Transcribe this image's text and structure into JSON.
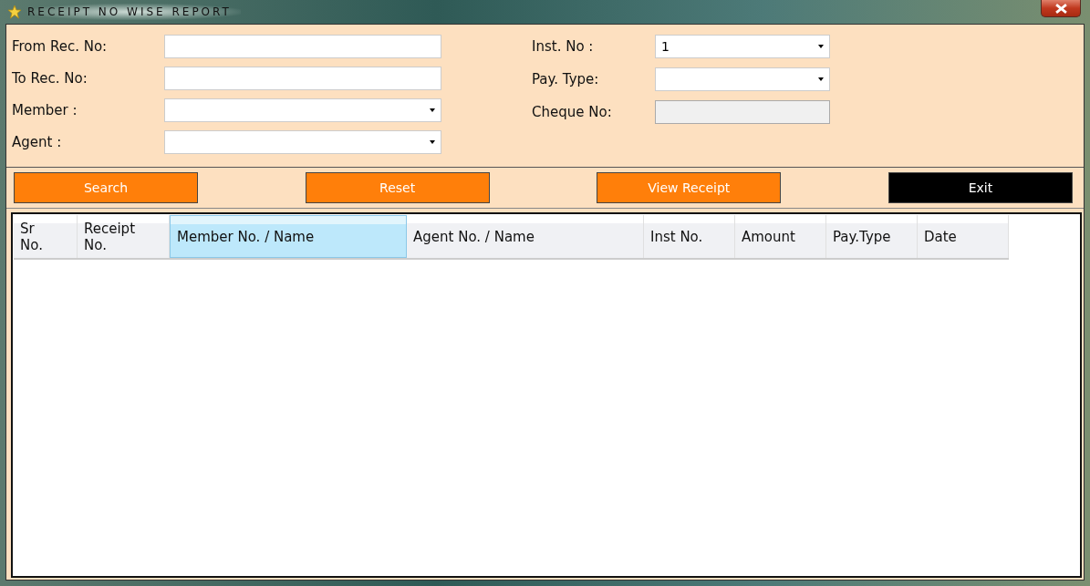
{
  "window": {
    "title": "RECEIPT NO WISE REPORT"
  },
  "left_fields": [
    {
      "label": "From Rec. No:",
      "kind": "text"
    },
    {
      "label": "To Rec. No:",
      "kind": "text"
    },
    {
      "label": "Member :",
      "kind": "select"
    },
    {
      "label": "Agent :",
      "kind": "select"
    }
  ],
  "right_fields": [
    {
      "label": "Inst. No :",
      "kind": "select",
      "value": "1"
    },
    {
      "label": "Pay. Type:",
      "kind": "select"
    },
    {
      "label": "Cheque No:",
      "kind": "disabled"
    }
  ],
  "buttons": [
    {
      "label": "Search",
      "kind": "primary"
    },
    {
      "label": "Reset",
      "kind": "primary"
    },
    {
      "label": "View Receipt",
      "kind": "primary"
    },
    {
      "label": "Exit",
      "kind": "dark"
    }
  ],
  "table": {
    "columns": [
      {
        "label": "Sr\nNo.",
        "selected": false
      },
      {
        "label": "Receipt\nNo.",
        "selected": false
      },
      {
        "label": "Member No. / Name",
        "selected": true
      },
      {
        "label": "Agent No. / Name",
        "selected": false
      },
      {
        "label": "Inst No.",
        "selected": false
      },
      {
        "label": "Amount",
        "selected": false
      },
      {
        "label": "Pay.Type",
        "selected": false
      },
      {
        "label": "Date",
        "selected": false
      }
    ]
  }
}
